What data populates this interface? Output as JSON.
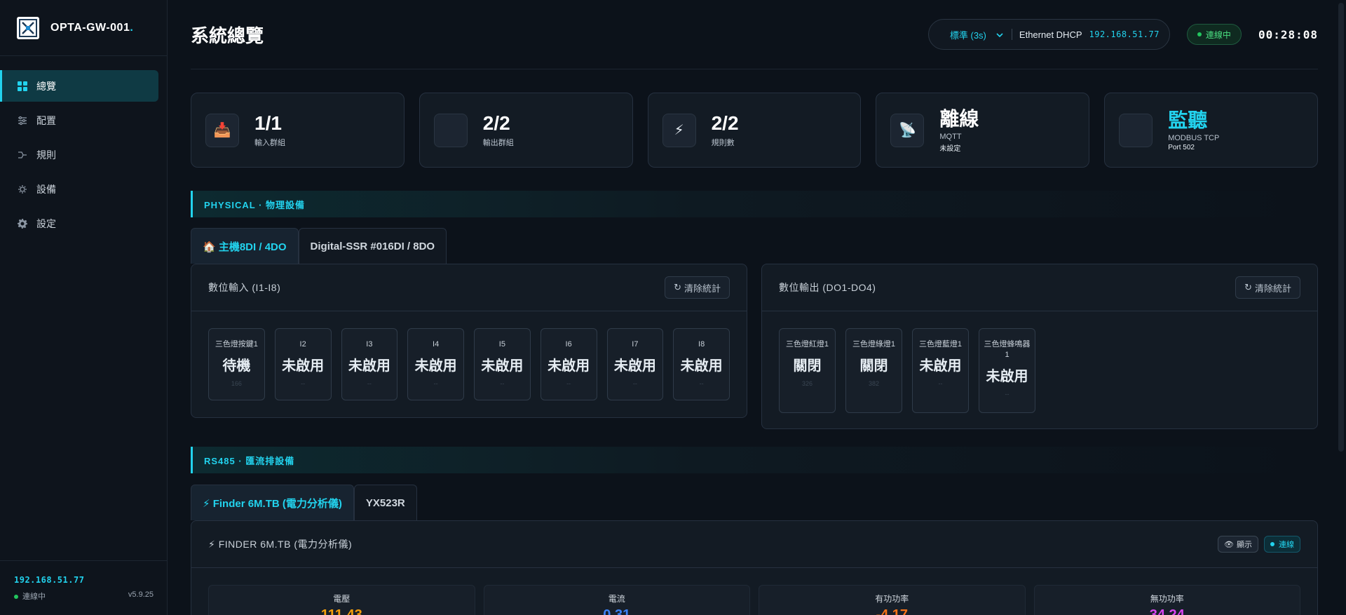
{
  "app": {
    "name": "OPTA-GW-001",
    "name_dot": "."
  },
  "sidebar": {
    "items": [
      {
        "label": "總覽",
        "icon": "grid-icon",
        "active": true
      },
      {
        "label": "配置",
        "icon": "sliders-icon"
      },
      {
        "label": "規則",
        "icon": "flow-icon"
      },
      {
        "label": "設備",
        "icon": "chip-icon"
      },
      {
        "label": "設定",
        "icon": "gear-icon"
      }
    ],
    "footer": {
      "ip": "192.168.51.77",
      "status": "連線中",
      "version": "v5.9.25"
    }
  },
  "header": {
    "title": "系統總覽",
    "mode": "標準 (3s)",
    "network": "Ethernet DHCP",
    "ip": "192.168.51.77",
    "connection": "連線中",
    "clock": "00:28:08"
  },
  "stats": [
    {
      "icon": "📥",
      "value": "1/1",
      "label": "輸入群組",
      "sub": ""
    },
    {
      "icon": "",
      "value": "2/2",
      "label": "輸出群組",
      "sub": ""
    },
    {
      "icon": "⚡",
      "value": "2/2",
      "label": "規則數",
      "sub": ""
    },
    {
      "icon": "📡",
      "value": "離線",
      "label": "MQTT",
      "sub": "未設定"
    },
    {
      "icon": "",
      "value": "監聽",
      "label": "MODBUS TCP",
      "sub": "Port 502"
    }
  ],
  "physical": {
    "section_title": "PHYSICAL · 物理設備",
    "tabs": [
      "🏠 主機8DI / 4DO",
      "Digital-SSR #016DI / 8DO"
    ],
    "inputs": {
      "title": "數位輸入 (I1-I8)",
      "clear_label": "清除統計",
      "items": [
        {
          "name": "三色燈按鍵1",
          "state": "待機",
          "count": "166"
        },
        {
          "name": "I2",
          "state": "未啟用",
          "count": "--"
        },
        {
          "name": "I3",
          "state": "未啟用",
          "count": "--"
        },
        {
          "name": "I4",
          "state": "未啟用",
          "count": "--"
        },
        {
          "name": "I5",
          "state": "未啟用",
          "count": "--"
        },
        {
          "name": "I6",
          "state": "未啟用",
          "count": "--"
        },
        {
          "name": "I7",
          "state": "未啟用",
          "count": "--"
        },
        {
          "name": "I8",
          "state": "未啟用",
          "count": "--"
        }
      ]
    },
    "outputs": {
      "title": "數位輸出 (DO1-DO4)",
      "clear_label": "清除統計",
      "items": [
        {
          "name": "三色燈紅燈1",
          "state": "關閉",
          "count": "326"
        },
        {
          "name": "三色燈綠燈1",
          "state": "關閉",
          "count": "382"
        },
        {
          "name": "三色燈藍燈1",
          "state": "未啟用",
          "count": "--"
        },
        {
          "name": "三色燈蜂鳴器1",
          "state": "未啟用",
          "count": "--"
        }
      ]
    }
  },
  "rs485": {
    "section_title": "RS485 · 匯流排設備",
    "tabs": [
      "⚡ Finder 6M.TB (電力分析儀)",
      "YX523R"
    ],
    "device": {
      "title": "⚡ FINDER 6M.TB (電力分析儀)",
      "show_label": "顯示",
      "conn_label": "連線",
      "metrics": [
        {
          "label": "電壓",
          "value": "111.43",
          "color": "#f59e0b"
        },
        {
          "label": "電流",
          "value": "0.31",
          "color": "#3b82f6"
        },
        {
          "label": "有功功率",
          "value": "-4.17",
          "color": "#f97316"
        },
        {
          "label": "無功功率",
          "value": "34.24",
          "color": "#d946ef"
        }
      ]
    }
  }
}
